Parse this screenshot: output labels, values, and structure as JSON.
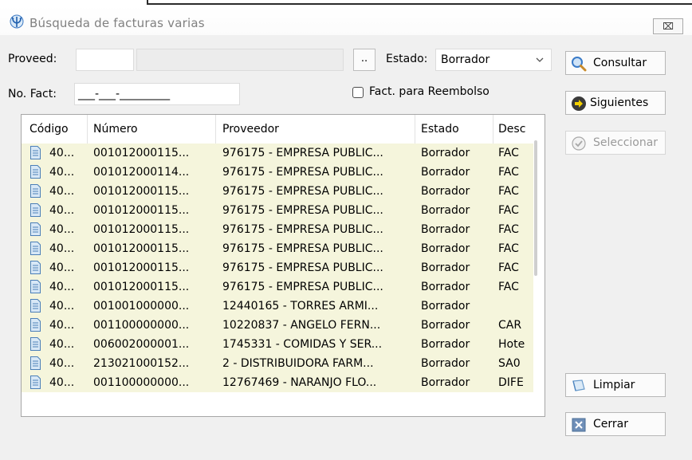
{
  "window": {
    "title": "Búsqueda de facturas varias",
    "close_glyph": "⌧"
  },
  "form": {
    "proveed_label": "Proveed:",
    "proveed_code": "",
    "proveed_name": "",
    "browse_label": "..",
    "estado_label": "Estado:",
    "estado_value": "Borrador",
    "nofact_label": "No. Fact:",
    "nofact_value": "___-___-_________",
    "reembolso_label": "Fact. para Reembolso",
    "reembolso_checked": false
  },
  "table": {
    "columns": [
      "Código",
      "Número",
      "Proveedor",
      "Estado",
      "Desc"
    ],
    "rows": [
      [
        "40...",
        "001012000115...",
        "976175 - EMPRESA PUBLIC...",
        "Borrador",
        "FAC"
      ],
      [
        "40...",
        "001012000114...",
        "976175 - EMPRESA PUBLIC...",
        "Borrador",
        "FAC"
      ],
      [
        "40...",
        "001012000115...",
        "976175 - EMPRESA PUBLIC...",
        "Borrador",
        "FAC"
      ],
      [
        "40...",
        "001012000115...",
        "976175 - EMPRESA PUBLIC...",
        "Borrador",
        "FAC"
      ],
      [
        "40...",
        "001012000115...",
        "976175 - EMPRESA PUBLIC...",
        "Borrador",
        "FAC"
      ],
      [
        "40...",
        "001012000115...",
        "976175 - EMPRESA PUBLIC...",
        "Borrador",
        "FAC"
      ],
      [
        "40...",
        "001012000115...",
        "976175 - EMPRESA PUBLIC...",
        "Borrador",
        "FAC"
      ],
      [
        "40...",
        "001012000115...",
        "976175 - EMPRESA PUBLIC...",
        "Borrador",
        "FAC"
      ],
      [
        "40...",
        "001001000000...",
        "12440165 - TORRES ARMI...",
        "Borrador",
        ""
      ],
      [
        "40...",
        "001100000000...",
        "10220837 - ANGELO FERN...",
        "Borrador",
        "CAR"
      ],
      [
        "40...",
        "006002000001...",
        "1745331 - COMIDAS Y SER...",
        "Borrador",
        "Hote"
      ],
      [
        "40...",
        "213021000152...",
        "2 - DISTRIBUIDORA FARM...",
        "Borrador",
        "SA0"
      ],
      [
        "40...",
        "001100000000...",
        "12767469 - NARANJO FLO...",
        "Borrador",
        "DIFE"
      ]
    ],
    "row_icon": "document-icon",
    "row_highlight_color": "#f5f5dc"
  },
  "actions": {
    "consultar": "Consultar",
    "siguientes": "Siguientes",
    "seleccionar": "Seleccionar",
    "limpiar": "Limpiar",
    "cerrar": "Cerrar"
  },
  "icons": {
    "app": "trident-icon",
    "consultar": "magnifier-icon",
    "siguientes": "arrow-right-icon",
    "seleccionar": "check-circle-icon",
    "limpiar": "eraser-icon",
    "cerrar": "close-x-icon"
  }
}
